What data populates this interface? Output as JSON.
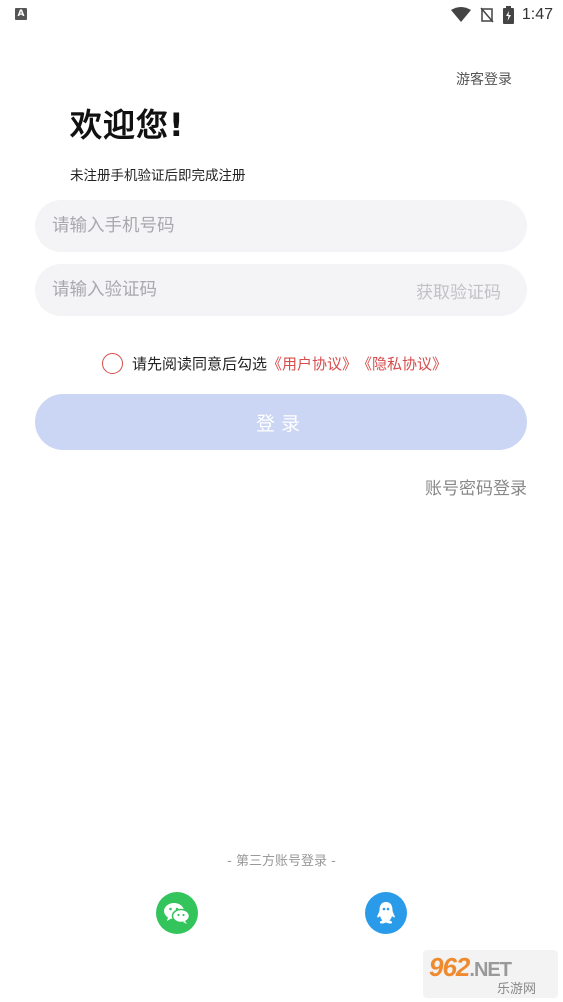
{
  "status_bar": {
    "time": "1:47",
    "notification_letter": "A"
  },
  "header": {
    "guest_login": "游客登录",
    "title": "欢迎您!",
    "subtitle": "未注册手机验证后即完成注册"
  },
  "form": {
    "phone_placeholder": "请输入手机号码",
    "code_placeholder": "请输入验证码",
    "get_code_label": "获取验证码",
    "agreement_prefix": "请先阅读同意后勾选",
    "user_agreement": "《用户协议》",
    "privacy_policy": "《隐私协议》",
    "login_label": "登录",
    "password_login": "账号密码登录"
  },
  "third_party": {
    "title": "- 第三方账号登录 -",
    "providers": [
      "wechat-icon",
      "qq-icon"
    ]
  },
  "watermark": {
    "main": "962",
    "suffix": ".NET",
    "sub": "乐游网"
  },
  "colors": {
    "accent_red": "#d84b4b",
    "login_button": "#cbd6f4",
    "wechat": "#33c45c",
    "qq": "#2a9be8"
  }
}
